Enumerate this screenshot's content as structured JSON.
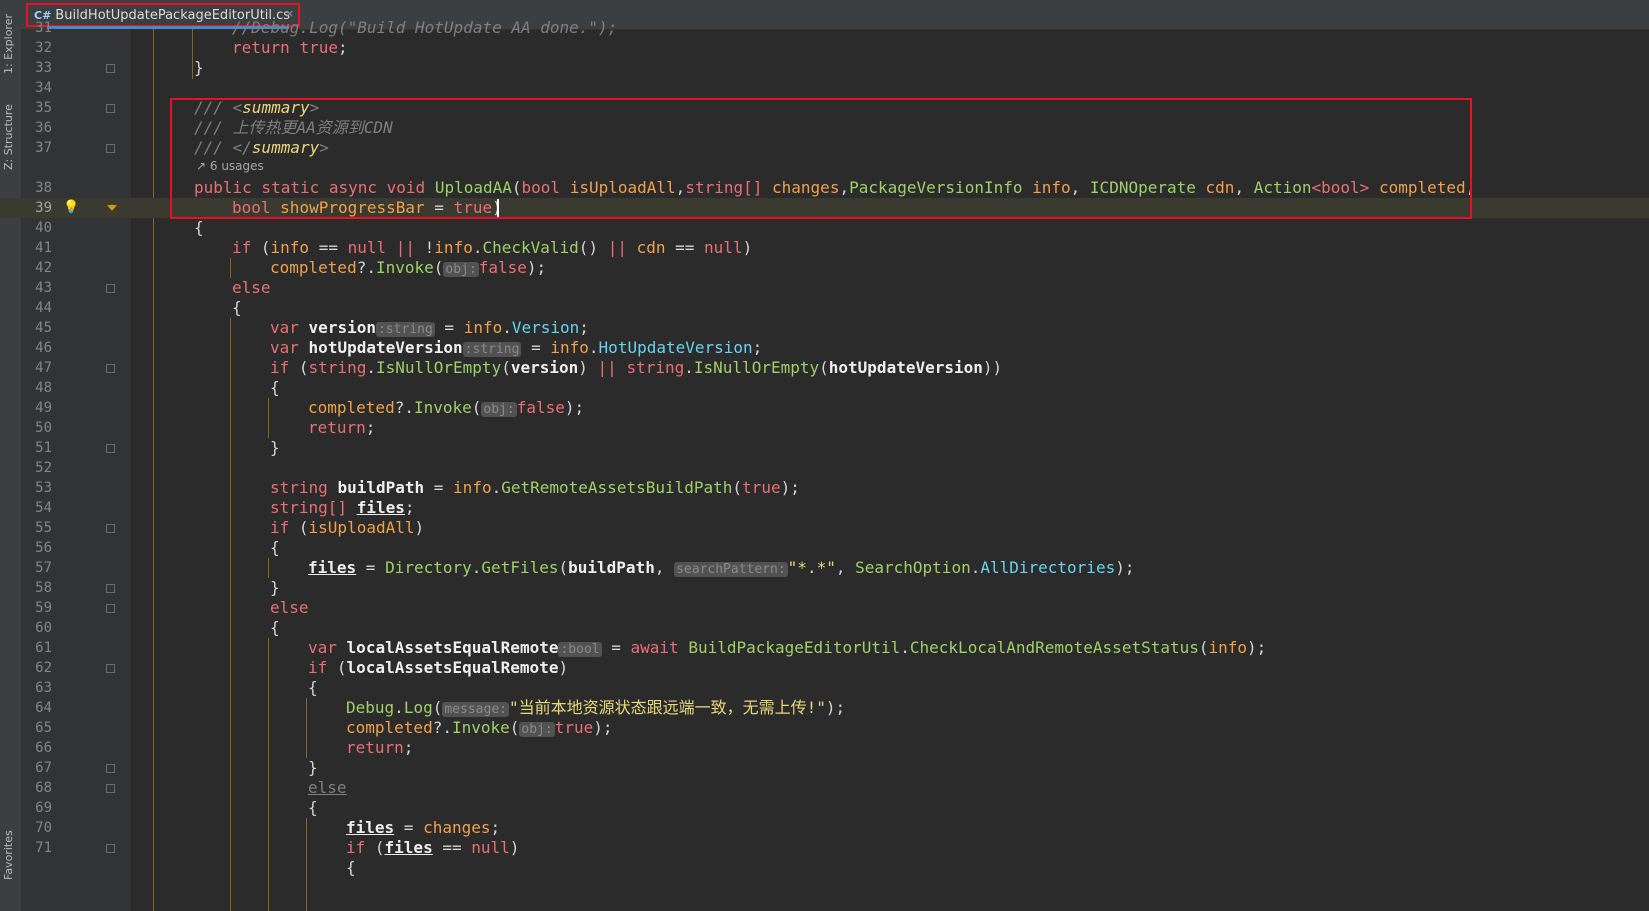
{
  "sidebar": {
    "explorer_label": "1: Explorer",
    "structure_label": "Z: Structure",
    "favorites_label": "Favorites"
  },
  "editor": {
    "tab_title": "BuildHotUpdatePackageEditorUtil.cs",
    "tab_icon": "C#"
  },
  "code": {
    "line_numbers": [
      "31",
      "32",
      "33",
      "34",
      "35",
      "36",
      "37",
      "38",
      "39",
      "40",
      "41",
      "42",
      "43",
      "44",
      "45",
      "46",
      "47",
      "48",
      "49",
      "50",
      "51",
      "52",
      "53",
      "54",
      "55",
      "56",
      "57",
      "58",
      "59",
      "60",
      "61",
      "62",
      "63",
      "64",
      "65",
      "66",
      "67",
      "68",
      "69",
      "70",
      "71"
    ],
    "l31": "//Debug.Log(\"Build HotUpdate AA done.\");",
    "l32": {
      "kw": "return",
      "val": "true"
    },
    "l35": {
      "open": "/// <",
      "tag": "summary",
      "close": ">"
    },
    "l36": "/// 上传热更AA资源到CDN",
    "l37": {
      "open": "/// </",
      "tag": "summary",
      "close": ">"
    },
    "usages": "6 usages",
    "l38": {
      "mods": "public static async void",
      "name": "UploadAA",
      "p1t": "bool",
      "p1": "isUploadAll",
      "p2t": "string[]",
      "p2": "changes",
      "p3t": "PackageVersionInfo",
      "p3": "info",
      "p4t": "ICDNOperate",
      "p4": "cdn",
      "p5t": "Action",
      "p5g": "<bool>",
      "p5": "completed"
    },
    "l39": {
      "t": "bool",
      "n": "showProgressBar",
      "v": "true"
    },
    "l41": {
      "if": "if",
      "info": "info",
      "null": "null",
      "chk": "CheckValid",
      "cdn": "cdn"
    },
    "l42": {
      "obj": "completed",
      "inv": "Invoke",
      "hint": "obj:",
      "val": "false"
    },
    "l43": "else",
    "l45": {
      "var": "var",
      "name": "version",
      "hint": ":string",
      "src": "info",
      "prop": "Version"
    },
    "l46": {
      "var": "var",
      "name": "hotUpdateVersion",
      "hint": ":string",
      "src": "info",
      "prop": "HotUpdateVersion"
    },
    "l47": {
      "if": "if",
      "t": "string",
      "m": "IsNullOrEmpty",
      "a": "version",
      "b": "hotUpdateVersion"
    },
    "l49": {
      "obj": "completed",
      "inv": "Invoke",
      "hint": "obj:",
      "val": "false"
    },
    "l50": "return",
    "l53": {
      "t": "string",
      "n": "buildPath",
      "src": "info",
      "m": "GetRemoteAssetsBuildPath",
      "v": "true"
    },
    "l54": {
      "t": "string[]",
      "n": "files"
    },
    "l55": {
      "if": "if",
      "c": "isUploadAll"
    },
    "l57": {
      "n": "files",
      "cls": "Directory",
      "m": "GetFiles",
      "a": "buildPath",
      "hint": "searchPattern:",
      "s": "\"*.*\"",
      "e": "SearchOption",
      "ev": "AllDirectories"
    },
    "l59": "else",
    "l61": {
      "var": "var",
      "n": "localAssetsEqualRemote",
      "hint": ":bool",
      "aw": "await",
      "cls": "BuildPackageEditorUtil",
      "m": "CheckLocalAndRemoteAssetStatus",
      "a": "info"
    },
    "l62": {
      "if": "if",
      "c": "localAssetsEqualRemote"
    },
    "l64": {
      "cls": "Debug",
      "m": "Log",
      "hint": "message:",
      "s": "\"当前本地资源状态跟远端一致，无需上传!\""
    },
    "l65": {
      "obj": "completed",
      "inv": "Invoke",
      "hint": "obj:",
      "val": "true"
    },
    "l66": "return",
    "l68": "else",
    "l70": {
      "n": "files",
      "v": "changes"
    },
    "l71": {
      "if": "if",
      "n": "files",
      "null": "null"
    }
  }
}
